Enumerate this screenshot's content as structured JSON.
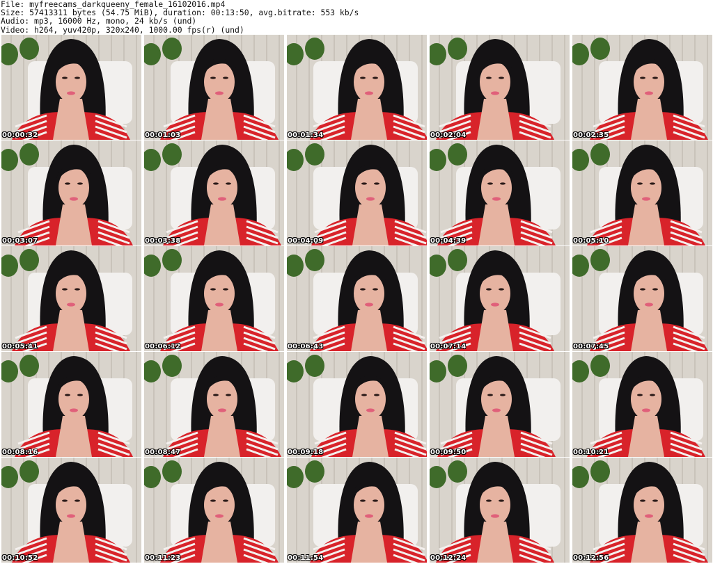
{
  "header": {
    "line1": "File: myfreecams_darkqueeny_female_16102016.mp4",
    "line2": "Size: 57413311 bytes (54.75 MiB), duration: 00:13:50, avg.bitrate: 553 kb/s",
    "line3": "Audio: mp3, 16000 Hz, mono, 24 kb/s (und)",
    "line4": "Video: h264, yuv420p, 320x240, 1000.00 fps(r) (und)"
  },
  "thumbnails": [
    {
      "timestamp": "00:00:32"
    },
    {
      "timestamp": "00:01:03"
    },
    {
      "timestamp": "00:01:34"
    },
    {
      "timestamp": "00:02:04"
    },
    {
      "timestamp": "00:02:35"
    },
    {
      "timestamp": "00:03:07"
    },
    {
      "timestamp": "00:03:38"
    },
    {
      "timestamp": "00:04:09"
    },
    {
      "timestamp": "00:04:39"
    },
    {
      "timestamp": "00:05:10"
    },
    {
      "timestamp": "00:05:41"
    },
    {
      "timestamp": "00:06:12"
    },
    {
      "timestamp": "00:06:43"
    },
    {
      "timestamp": "00:07:14"
    },
    {
      "timestamp": "00:07:45"
    },
    {
      "timestamp": "00:08:16"
    },
    {
      "timestamp": "00:08:47"
    },
    {
      "timestamp": "00:09:18"
    },
    {
      "timestamp": "00:09:50"
    },
    {
      "timestamp": "00:10:21"
    },
    {
      "timestamp": "00:10:52"
    },
    {
      "timestamp": "00:11:23"
    },
    {
      "timestamp": "00:11:54"
    },
    {
      "timestamp": "00:12:24"
    },
    {
      "timestamp": "00:12:56"
    }
  ],
  "colors": {
    "wall": "#d9d4cc",
    "plank_line": "#b9b2a8",
    "plant": "#3f6b2a",
    "chair": "#f2f0ee",
    "hair": "#141214",
    "skin": "#e6b3a1",
    "shirt_red": "#d8232a",
    "shirt_stripe": "#f4f0ee",
    "lips": "#e0607a"
  }
}
